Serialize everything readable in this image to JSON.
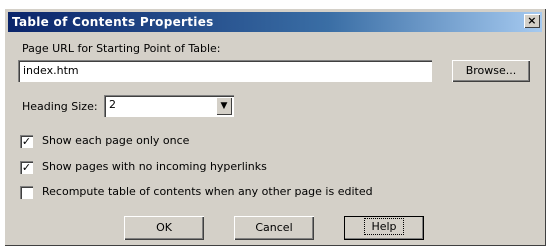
{
  "dialog": {
    "title": "Table of Contents Properties",
    "close_glyph": "×"
  },
  "url": {
    "label": "Page URL for Starting Point of Table:",
    "value": "index.htm",
    "browse_label": "Browse..."
  },
  "heading_size": {
    "label": "Heading Size:",
    "value": "2",
    "arrow_glyph": "▼"
  },
  "options": [
    {
      "label": "Show each page only once",
      "checked": true
    },
    {
      "label": "Show pages with no incoming hyperlinks",
      "checked": true
    },
    {
      "label": "Recompute table of contents when any other page is edited",
      "checked": false
    }
  ],
  "check_glyph": "✓",
  "buttons": {
    "ok": "OK",
    "cancel": "Cancel",
    "help": "Help"
  }
}
